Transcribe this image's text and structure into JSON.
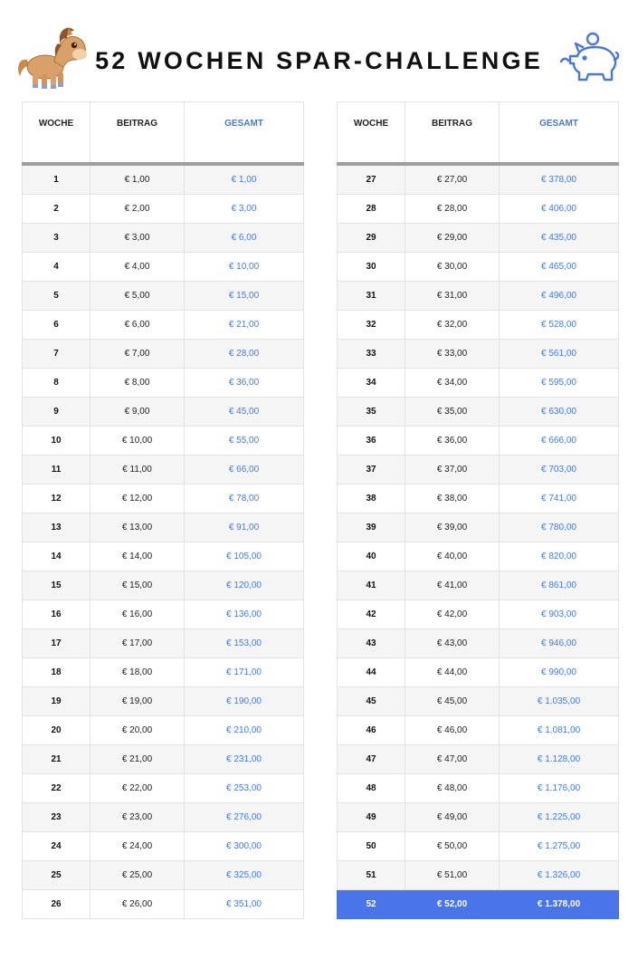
{
  "title": "52 WOCHEN SPAR-CHALLENGE",
  "icons": {
    "left": "pony-icon",
    "right": "piggy-bank-icon"
  },
  "colors": {
    "accent": "#4a78d8",
    "highlight": "#4a74ea",
    "header_rule": "#9e9e9e"
  },
  "table": {
    "headers": {
      "week": "WOCHE",
      "contribution": "BEITRAG",
      "total": "GESAMT"
    },
    "left": [
      {
        "week": "1",
        "amount": "€ 1,00",
        "total": "€ 1,00"
      },
      {
        "week": "2",
        "amount": "€ 2,00",
        "total": "€ 3,00"
      },
      {
        "week": "3",
        "amount": "€ 3,00",
        "total": "€ 6,00"
      },
      {
        "week": "4",
        "amount": "€ 4,00",
        "total": "€ 10,00"
      },
      {
        "week": "5",
        "amount": "€ 5,00",
        "total": "€ 15,00"
      },
      {
        "week": "6",
        "amount": "€ 6,00",
        "total": "€ 21,00"
      },
      {
        "week": "7",
        "amount": "€ 7,00",
        "total": "€ 28,00"
      },
      {
        "week": "8",
        "amount": "€ 8,00",
        "total": "€ 36,00"
      },
      {
        "week": "9",
        "amount": "€ 9,00",
        "total": "€ 45,00"
      },
      {
        "week": "10",
        "amount": "€ 10,00",
        "total": "€ 55,00"
      },
      {
        "week": "11",
        "amount": "€ 11,00",
        "total": "€ 66,00"
      },
      {
        "week": "12",
        "amount": "€ 12,00",
        "total": "€ 78,00"
      },
      {
        "week": "13",
        "amount": "€ 13,00",
        "total": "€ 91,00"
      },
      {
        "week": "14",
        "amount": "€ 14,00",
        "total": "€ 105,00"
      },
      {
        "week": "15",
        "amount": "€ 15,00",
        "total": "€ 120,00"
      },
      {
        "week": "16",
        "amount": "€ 16,00",
        "total": "€ 136,00"
      },
      {
        "week": "17",
        "amount": "€ 17,00",
        "total": "€ 153,00"
      },
      {
        "week": "18",
        "amount": "€ 18,00",
        "total": "€ 171,00"
      },
      {
        "week": "19",
        "amount": "€ 19,00",
        "total": "€ 190,00"
      },
      {
        "week": "20",
        "amount": "€ 20,00",
        "total": "€ 210,00"
      },
      {
        "week": "21",
        "amount": "€ 21,00",
        "total": "€ 231,00"
      },
      {
        "week": "22",
        "amount": "€ 22,00",
        "total": "€ 253,00"
      },
      {
        "week": "23",
        "amount": "€ 23,00",
        "total": "€ 276,00"
      },
      {
        "week": "24",
        "amount": "€ 24,00",
        "total": "€ 300,00"
      },
      {
        "week": "25",
        "amount": "€ 25,00",
        "total": "€ 325,00"
      },
      {
        "week": "26",
        "amount": "€ 26,00",
        "total": "€ 351,00"
      }
    ],
    "right": [
      {
        "week": "27",
        "amount": "€ 27,00",
        "total": "€ 378,00"
      },
      {
        "week": "28",
        "amount": "€ 28,00",
        "total": "€ 406,00"
      },
      {
        "week": "29",
        "amount": "€ 29,00",
        "total": "€ 435,00"
      },
      {
        "week": "30",
        "amount": "€ 30,00",
        "total": "€ 465,00"
      },
      {
        "week": "31",
        "amount": "€ 31,00",
        "total": "€ 496,00"
      },
      {
        "week": "32",
        "amount": "€ 32,00",
        "total": "€ 528,00"
      },
      {
        "week": "33",
        "amount": "€ 33,00",
        "total": "€ 561,00"
      },
      {
        "week": "34",
        "amount": "€ 34,00",
        "total": "€ 595,00"
      },
      {
        "week": "35",
        "amount": "€ 35,00",
        "total": "€ 630,00"
      },
      {
        "week": "36",
        "amount": "€ 36,00",
        "total": "€ 666,00"
      },
      {
        "week": "37",
        "amount": "€ 37,00",
        "total": "€ 703,00"
      },
      {
        "week": "38",
        "amount": "€ 38,00",
        "total": "€ 741,00"
      },
      {
        "week": "39",
        "amount": "€ 39,00",
        "total": "€ 780,00"
      },
      {
        "week": "40",
        "amount": "€ 40,00",
        "total": "€ 820,00"
      },
      {
        "week": "41",
        "amount": "€ 41,00",
        "total": "€ 861,00"
      },
      {
        "week": "42",
        "amount": "€ 42,00",
        "total": "€ 903,00"
      },
      {
        "week": "43",
        "amount": "€ 43,00",
        "total": "€ 946,00"
      },
      {
        "week": "44",
        "amount": "€ 44,00",
        "total": "€ 990,00"
      },
      {
        "week": "45",
        "amount": "€ 45,00",
        "total": "€ 1.035,00"
      },
      {
        "week": "46",
        "amount": "€ 46,00",
        "total": "€ 1.081,00"
      },
      {
        "week": "47",
        "amount": "€ 47,00",
        "total": "€ 1.128,00"
      },
      {
        "week": "48",
        "amount": "€ 48,00",
        "total": "€ 1.176,00"
      },
      {
        "week": "49",
        "amount": "€ 49,00",
        "total": "€ 1.225,00"
      },
      {
        "week": "50",
        "amount": "€ 50,00",
        "total": "€ 1.275,00"
      },
      {
        "week": "51",
        "amount": "€ 51,00",
        "total": "€ 1.326,00"
      },
      {
        "week": "52",
        "amount": "€ 52,00",
        "total": "€ 1.378,00",
        "highlight": true
      }
    ]
  }
}
